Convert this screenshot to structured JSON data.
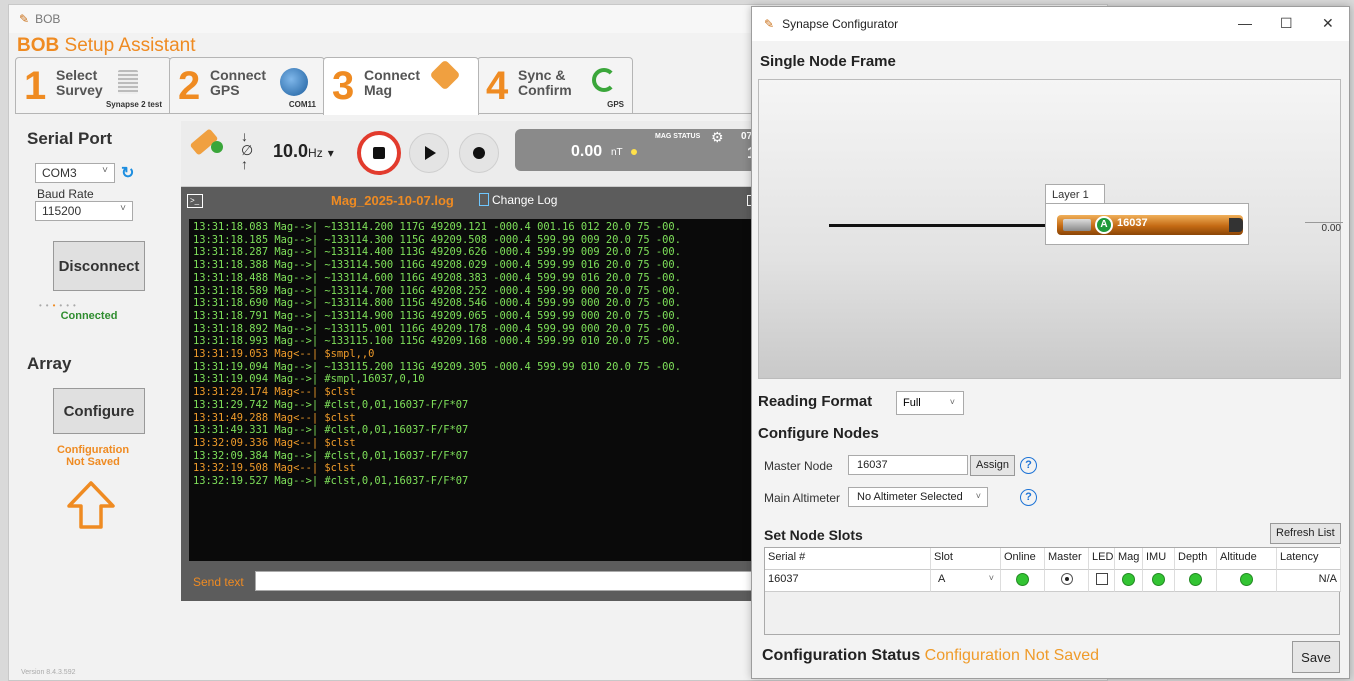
{
  "bob": {
    "window_title": "BOB",
    "header_brand": "BOB",
    "header_title": "Setup Assistant",
    "tabs": [
      {
        "num": "1",
        "label1": "Select",
        "label2": "Survey",
        "sub": "Synapse 2 test"
      },
      {
        "num": "2",
        "label1": "Connect",
        "label2": "GPS",
        "sub": "COM11"
      },
      {
        "num": "3",
        "label1": "Connect",
        "label2": "Mag",
        "sub": ""
      },
      {
        "num": "4",
        "label1": "Sync &",
        "label2": "Confirm",
        "sub": "GPS"
      }
    ],
    "serial": {
      "title": "Serial Port",
      "port": "COM3",
      "baud_label": "Baud Rate",
      "baud": "115200",
      "disconnect_label": "Disconnect",
      "status": "Connected"
    },
    "array": {
      "title": "Array",
      "configure_label": "Configure",
      "config_status": "Configuration Not Saved"
    },
    "toolbar": {
      "rate_value": "10.0",
      "rate_unit": "Hz",
      "mag_value": "0.00",
      "mag_unit": "nT",
      "mag_status_label": "MAG STATUS",
      "clipped_top": "07",
      "clipped_bottom": "13"
    },
    "log": {
      "file_name": "Mag_2025-10-07.log",
      "change_log_label": "Change Log",
      "lines": [
        {
          "dir": "in",
          "text": "13:31:18.083 Mag-->| ~133114.200 117G 49209.121 -000.4 001.16 012 20.0 75 -00."
        },
        {
          "dir": "in",
          "text": "13:31:18.185 Mag-->| ~133114.300 115G 49209.508 -000.4 599.99 009 20.0 75 -00."
        },
        {
          "dir": "in",
          "text": "13:31:18.287 Mag-->| ~133114.400 113G 49209.626 -000.4 599.99 009 20.0 75 -00."
        },
        {
          "dir": "in",
          "text": "13:31:18.388 Mag-->| ~133114.500 116G 49208.029 -000.4 599.99 016 20.0 75 -00."
        },
        {
          "dir": "in",
          "text": "13:31:18.488 Mag-->| ~133114.600 116G 49208.383 -000.4 599.99 016 20.0 75 -00."
        },
        {
          "dir": "in",
          "text": "13:31:18.589 Mag-->| ~133114.700 116G 49208.252 -000.4 599.99 000 20.0 75 -00."
        },
        {
          "dir": "in",
          "text": "13:31:18.690 Mag-->| ~133114.800 115G 49208.546 -000.4 599.99 000 20.0 75 -00."
        },
        {
          "dir": "in",
          "text": "13:31:18.791 Mag-->| ~133114.900 113G 49209.065 -000.4 599.99 000 20.0 75 -00."
        },
        {
          "dir": "in",
          "text": "13:31:18.892 Mag-->| ~133115.001 116G 49209.178 -000.4 599.99 000 20.0 75 -00."
        },
        {
          "dir": "in",
          "text": "13:31:18.993 Mag-->| ~133115.100 115G 49209.168 -000.4 599.99 010 20.0 75 -00."
        },
        {
          "dir": "out",
          "text": "13:31:19.053 Mag<--| $smpl,,0"
        },
        {
          "dir": "in",
          "text": "13:31:19.094 Mag-->| ~133115.200 113G 49209.305 -000.4 599.99 010 20.0 75 -00."
        },
        {
          "dir": "in",
          "text": "13:31:19.094 Mag-->| #smpl,16037,0,10"
        },
        {
          "dir": "out",
          "text": "13:31:29.174 Mag<--| $clst"
        },
        {
          "dir": "in",
          "text": "13:31:29.742 Mag-->| #clst,0,01,16037-F/F*07"
        },
        {
          "dir": "out",
          "text": "13:31:49.288 Mag<--| $clst"
        },
        {
          "dir": "in",
          "text": "13:31:49.331 Mag-->| #clst,0,01,16037-F/F*07"
        },
        {
          "dir": "out",
          "text": "13:32:09.336 Mag<--| $clst"
        },
        {
          "dir": "in",
          "text": "13:32:09.384 Mag-->| #clst,0,01,16037-F/F*07"
        },
        {
          "dir": "out",
          "text": "13:32:19.508 Mag<--| $clst"
        },
        {
          "dir": "in",
          "text": "13:32:19.527 Mag-->| #clst,0,01,16037-F/F*07"
        }
      ],
      "send_label": "Send text",
      "send_value": ""
    },
    "version": "Version 8.4.3.592"
  },
  "synapse": {
    "window_title": "Synapse Configurator",
    "frame_title": "Single Node Frame",
    "layer_label": "Layer 1",
    "node_letter": "A",
    "node_serial": "16037",
    "altitude_value": "0.00",
    "reading_format_label": "Reading Format",
    "reading_format": "Full",
    "configure_nodes_title": "Configure Nodes",
    "master_node_label": "Master Node",
    "master_node_value": "16037",
    "assign_label": "Assign",
    "main_altimeter_label": "Main Altimeter",
    "main_altimeter_value": "No Altimeter Selected",
    "set_slots_title": "Set Node Slots",
    "refresh_label": "Refresh List",
    "columns": [
      "Serial #",
      "Slot",
      "Online",
      "Master",
      "LED",
      "Mag",
      "IMU",
      "Depth",
      "Altitude",
      "Latency"
    ],
    "rows": [
      {
        "serial": "16037",
        "slot": "A",
        "online": true,
        "master": true,
        "led": false,
        "mag": true,
        "imu": true,
        "depth": true,
        "altitude": true,
        "latency": "N/A"
      }
    ],
    "status_label": "Configuration Status",
    "status_value": "Configuration Not Saved",
    "save_label": "Save"
  },
  "colors": {
    "accent": "#ef8b22",
    "console_in": "#7ee05a",
    "console_out": "#ef9b2a",
    "stop": "#e23b2d",
    "online": "#33c433"
  }
}
